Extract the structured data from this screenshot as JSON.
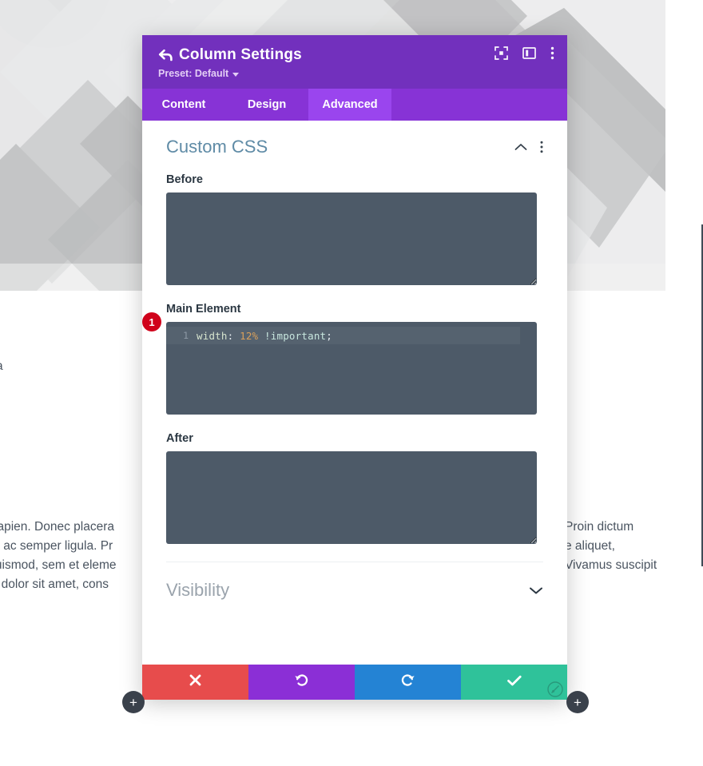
{
  "background": {
    "text_lines": {
      "middle": "massa",
      "left_block": [
        "ibus sapien. Donec placera",
        "rabitur ac semper ligula. Pr",
        "nec euismod, sem et eleme",
        "ipsum dolor sit amet, cons"
      ],
      "right_block": [
        "Proin dictum",
        "e aliquet,",
        "Vivamus suscipit"
      ]
    },
    "colors": {
      "pattern_base": "#ededee",
      "pattern_light": "#e2e3e4",
      "pattern_mid": "#d4d5d6",
      "pattern_dark": "#bcbdbe"
    }
  },
  "modal": {
    "title": "Column Settings",
    "back_icon": "back-arrow-icon",
    "preset_label": "Preset: Default",
    "header_actions": [
      {
        "name": "focus-icon",
        "label": "Focus"
      },
      {
        "name": "layout-panel-icon",
        "label": "Layout"
      },
      {
        "name": "more-options-icon",
        "label": "More Options"
      }
    ],
    "tabs": [
      {
        "label": "Content",
        "active": false
      },
      {
        "label": "Design",
        "active": false
      },
      {
        "label": "Advanced",
        "active": true
      }
    ],
    "section": {
      "title": "Custom CSS",
      "collapse_icon": "chevron-up-icon",
      "options_icon": "more-options-icon",
      "fields": [
        {
          "label": "Before",
          "value": "",
          "placeholder": ""
        },
        {
          "label": "Main Element",
          "value": "width: 12% !important;",
          "placeholder": ""
        },
        {
          "label": "After",
          "value": "",
          "placeholder": ""
        }
      ],
      "code": {
        "line_number": "1",
        "tokens": [
          {
            "text": "width",
            "type": "prop"
          },
          {
            "text": ":",
            "type": "punct"
          },
          {
            "text": " ",
            "type": "punct"
          },
          {
            "text": "12%",
            "type": "num"
          },
          {
            "text": " ",
            "type": "punct"
          },
          {
            "text": "!important",
            "type": "imp"
          },
          {
            "text": ";",
            "type": "punct"
          }
        ]
      },
      "step_badge": "1"
    },
    "visibility": {
      "title": "Visibility",
      "expand_icon": "chevron-down-icon"
    },
    "footer_buttons": [
      {
        "name": "cancel-button",
        "icon": "close-icon",
        "color": "#e74c4c"
      },
      {
        "name": "undo-button",
        "icon": "undo-icon",
        "color": "#8b2fd6"
      },
      {
        "name": "redo-button",
        "icon": "redo-icon",
        "color": "#2483d4"
      },
      {
        "name": "save-button",
        "icon": "checkmark-icon",
        "color": "#2fc29a"
      }
    ],
    "resize_handle_icon": "resize-handle-icon",
    "colors": {
      "header": "#7230bd",
      "tabs": "#8733d6",
      "tab_active": "#9a45ee",
      "section_title": "#5f8ba6",
      "textarea": "#4d5a68",
      "badge": "#d0021b"
    }
  },
  "floating_buttons": [
    {
      "name": "add-left-button",
      "label": "+"
    },
    {
      "name": "add-right-button",
      "label": "+"
    }
  ]
}
